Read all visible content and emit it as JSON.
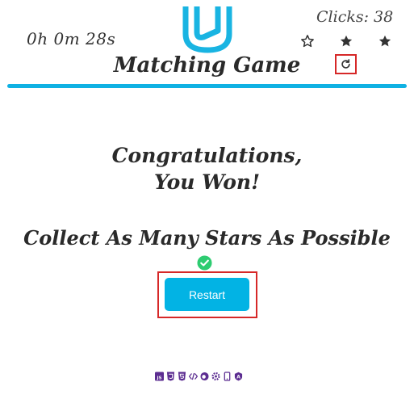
{
  "header": {
    "timer": "0h 0m 28s",
    "title": "Matching Game",
    "clicks": "Clicks: 38",
    "stars": [
      {
        "filled": false,
        "icon": "star-outline-icon"
      },
      {
        "filled": true,
        "icon": "star-filled-icon"
      },
      {
        "filled": true,
        "icon": "star-filled-icon"
      }
    ],
    "logo_icon": "udacity-logo",
    "restart_icon": "restart-icon"
  },
  "main": {
    "congrats_line1": "Congratulations,",
    "congrats_line2": "You Won!",
    "collect": "Collect As Many Stars As Possible",
    "check_icon": "check-circle-icon",
    "restart_label": "Restart"
  },
  "footer": {
    "icons": [
      "js-icon",
      "css3-icon",
      "html5-icon",
      "code-icon",
      "firefox-icon",
      "settings-icon",
      "mobile-icon",
      "accessibility-icon"
    ]
  },
  "colors": {
    "accent": "#02b3e4",
    "divider": "#0fb1e3",
    "highlight": "#d62828",
    "check": "#2ecc71",
    "footer_icon": "#5c2d91"
  }
}
